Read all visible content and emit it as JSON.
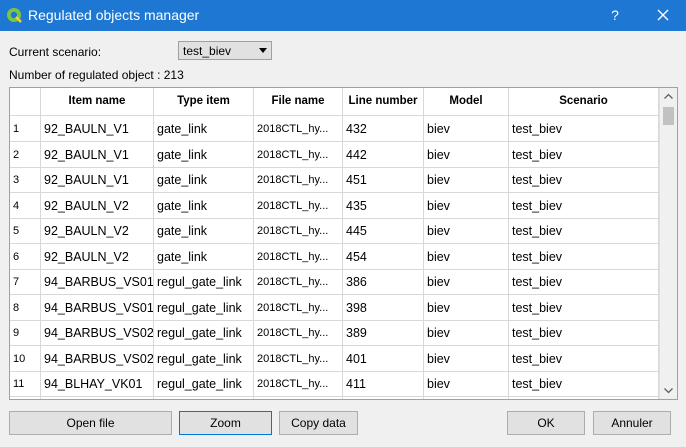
{
  "window": {
    "title": "Regulated objects manager",
    "help_label": "?"
  },
  "scenario": {
    "label": "Current scenario:",
    "selected": "test_biev"
  },
  "count_text": "Number of regulated object : 213",
  "table": {
    "columns": [
      "Item name",
      "Type item",
      "File name",
      "Line number",
      "Model",
      "Scenario"
    ],
    "rows": [
      {
        "n": "1",
        "item": "92_BAULN_V1",
        "type": "gate_link",
        "file": "2018CTL_hy...",
        "line": "432",
        "model": "biev",
        "scenario": "test_biev"
      },
      {
        "n": "2",
        "item": "92_BAULN_V1",
        "type": "gate_link",
        "file": "2018CTL_hy...",
        "line": "442",
        "model": "biev",
        "scenario": "test_biev"
      },
      {
        "n": "3",
        "item": "92_BAULN_V1",
        "type": "gate_link",
        "file": "2018CTL_hy...",
        "line": "451",
        "model": "biev",
        "scenario": "test_biev"
      },
      {
        "n": "4",
        "item": "92_BAULN_V2",
        "type": "gate_link",
        "file": "2018CTL_hy...",
        "line": "435",
        "model": "biev",
        "scenario": "test_biev"
      },
      {
        "n": "5",
        "item": "92_BAULN_V2",
        "type": "gate_link",
        "file": "2018CTL_hy...",
        "line": "445",
        "model": "biev",
        "scenario": "test_biev"
      },
      {
        "n": "6",
        "item": "92_BAULN_V2",
        "type": "gate_link",
        "file": "2018CTL_hy...",
        "line": "454",
        "model": "biev",
        "scenario": "test_biev"
      },
      {
        "n": "7",
        "item": "94_BARBUS_VS01",
        "type": "regul_gate_link",
        "file": "2018CTL_hy...",
        "line": "386",
        "model": "biev",
        "scenario": "test_biev"
      },
      {
        "n": "8",
        "item": "94_BARBUS_VS01",
        "type": "regul_gate_link",
        "file": "2018CTL_hy...",
        "line": "398",
        "model": "biev",
        "scenario": "test_biev"
      },
      {
        "n": "9",
        "item": "94_BARBUS_VS02",
        "type": "regul_gate_link",
        "file": "2018CTL_hy...",
        "line": "389",
        "model": "biev",
        "scenario": "test_biev"
      },
      {
        "n": "10",
        "item": "94_BARBUS_VS02",
        "type": "regul_gate_link",
        "file": "2018CTL_hy...",
        "line": "401",
        "model": "biev",
        "scenario": "test_biev"
      },
      {
        "n": "11",
        "item": "94_BLHAY_VK01",
        "type": "regul_gate_link",
        "file": "2018CTL_hy...",
        "line": "411",
        "model": "biev",
        "scenario": "test_biev"
      }
    ]
  },
  "buttons": {
    "open_file": "Open file",
    "zoom": "Zoom",
    "copy_data": "Copy data",
    "ok": "OK",
    "cancel": "Annuler"
  },
  "colors": {
    "titlebar": "#1e77d3",
    "app_icon": "#7cc443"
  }
}
